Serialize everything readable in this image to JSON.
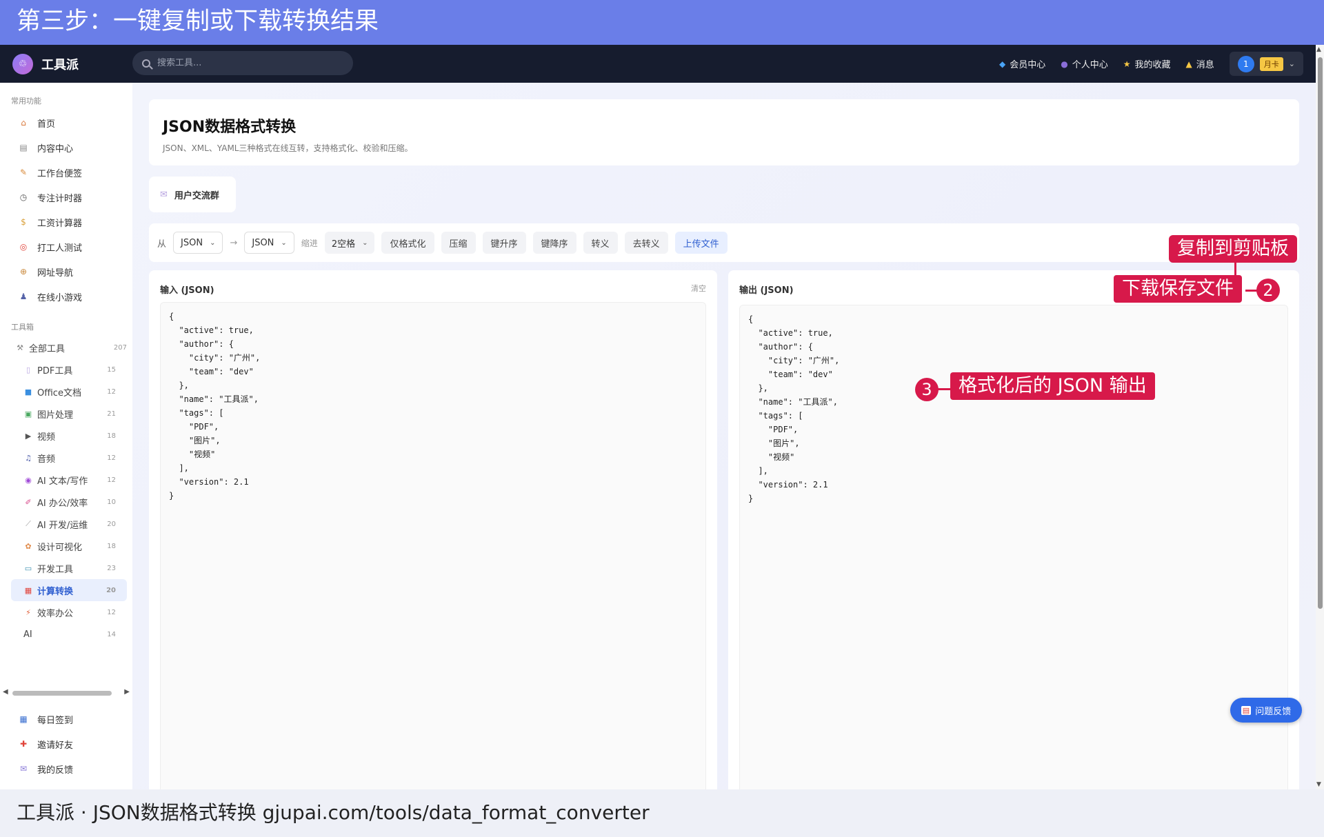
{
  "banner": {
    "text": "第三步：一键复制或下载转换结果"
  },
  "topbar": {
    "app_name": "工具派",
    "logo_glyph": "♲",
    "search_placeholder": "搜索工具...",
    "nav": [
      {
        "icon": "◆",
        "label": "会员中心"
      },
      {
        "icon": "●",
        "label": "个人中心"
      },
      {
        "icon": "★",
        "label": "我的收藏"
      },
      {
        "icon": "▲",
        "label": "消息"
      }
    ],
    "user_badge": "1",
    "vip_label": "月卡"
  },
  "sidebar": {
    "group1": "常用功能",
    "items": [
      {
        "icon": "⌂",
        "label": "首页"
      },
      {
        "icon": "▤",
        "label": "内容中心"
      },
      {
        "icon": "✎",
        "label": "工作台便签"
      },
      {
        "icon": "◷",
        "label": "专注计时器"
      },
      {
        "icon": "$",
        "label": "工资计算器"
      },
      {
        "icon": "◎",
        "label": "打工人测试"
      },
      {
        "icon": "⊕",
        "label": "网址导航"
      },
      {
        "icon": "♟",
        "label": "在线小游戏"
      }
    ],
    "group2": "工具箱",
    "all_tools": {
      "icon": "⚒",
      "label": "全部工具",
      "count": "207"
    },
    "categories": [
      {
        "icon": "▯",
        "label": "PDF工具",
        "count": "15"
      },
      {
        "icon": "■",
        "label": "Office文档",
        "count": "12"
      },
      {
        "icon": "▣",
        "label": "图片处理",
        "count": "21"
      },
      {
        "icon": "▶",
        "label": "视频",
        "count": "18"
      },
      {
        "icon": "♫",
        "label": "音频",
        "count": "12"
      },
      {
        "icon": "◉",
        "label": "AI 文本/写作",
        "count": "12"
      },
      {
        "icon": "✐",
        "label": "AI 办公/效率",
        "count": "10"
      },
      {
        "icon": "⟋",
        "label": "AI 开发/运维",
        "count": "20"
      },
      {
        "icon": "✿",
        "label": "设计可视化",
        "count": "18"
      },
      {
        "icon": "▭",
        "label": "开发工具",
        "count": "23"
      },
      {
        "icon": "▦",
        "label": "计算转换",
        "count": "20"
      },
      {
        "icon": "⚡",
        "label": "效率办公",
        "count": "12"
      },
      {
        "icon": "",
        "label": "AI",
        "count": "14"
      }
    ],
    "bottom": [
      {
        "icon": "▦",
        "label": "每日签到"
      },
      {
        "icon": "✚",
        "label": "邀请好友"
      },
      {
        "icon": "✉",
        "label": "我的反馈"
      }
    ]
  },
  "main": {
    "title": "JSON数据格式转换",
    "subtitle": "JSON、XML、YAML三种格式在线互转，支持格式化、校验和压缩。",
    "group_btn": "用户交流群",
    "toolbar": {
      "from_label": "从",
      "from_value": "JSON",
      "arrow": "→",
      "to_value": "JSON",
      "indent_label": "缩进",
      "indent_value": "2空格",
      "buttons": [
        "仅格式化",
        "压缩",
        "键升序",
        "键降序",
        "转义",
        "去转义"
      ],
      "upload": "上传文件"
    },
    "input": {
      "title": "输入 (JSON)",
      "clear": "清空",
      "code": "{\n  \"active\": true,\n  \"author\": {\n    \"city\": \"广州\",\n    \"team\": \"dev\"\n  },\n  \"name\": \"工具派\",\n  \"tags\": [\n    \"PDF\",\n    \"图片\",\n    \"视频\"\n  ],\n  \"version\": 2.1\n}"
    },
    "output": {
      "title": "输出 (JSON)",
      "code": "{\n  \"active\": true,\n  \"author\": {\n    \"city\": \"广州\",\n    \"team\": \"dev\"\n  },\n  \"name\": \"工具派\",\n  \"tags\": [\n    \"PDF\",\n    \"图片\",\n    \"视频\"\n  ],\n  \"version\": 2.1\n}"
    },
    "feedback": "问题反馈"
  },
  "callouts": {
    "copy": "复制到剪贴板",
    "download": "下载保存文件",
    "n2": "2",
    "formatted": "格式化后的 JSON 输出",
    "n3": "3"
  },
  "footer": {
    "text": "工具派 · JSON数据格式转换 gjupai.com/tools/data_format_converter"
  }
}
